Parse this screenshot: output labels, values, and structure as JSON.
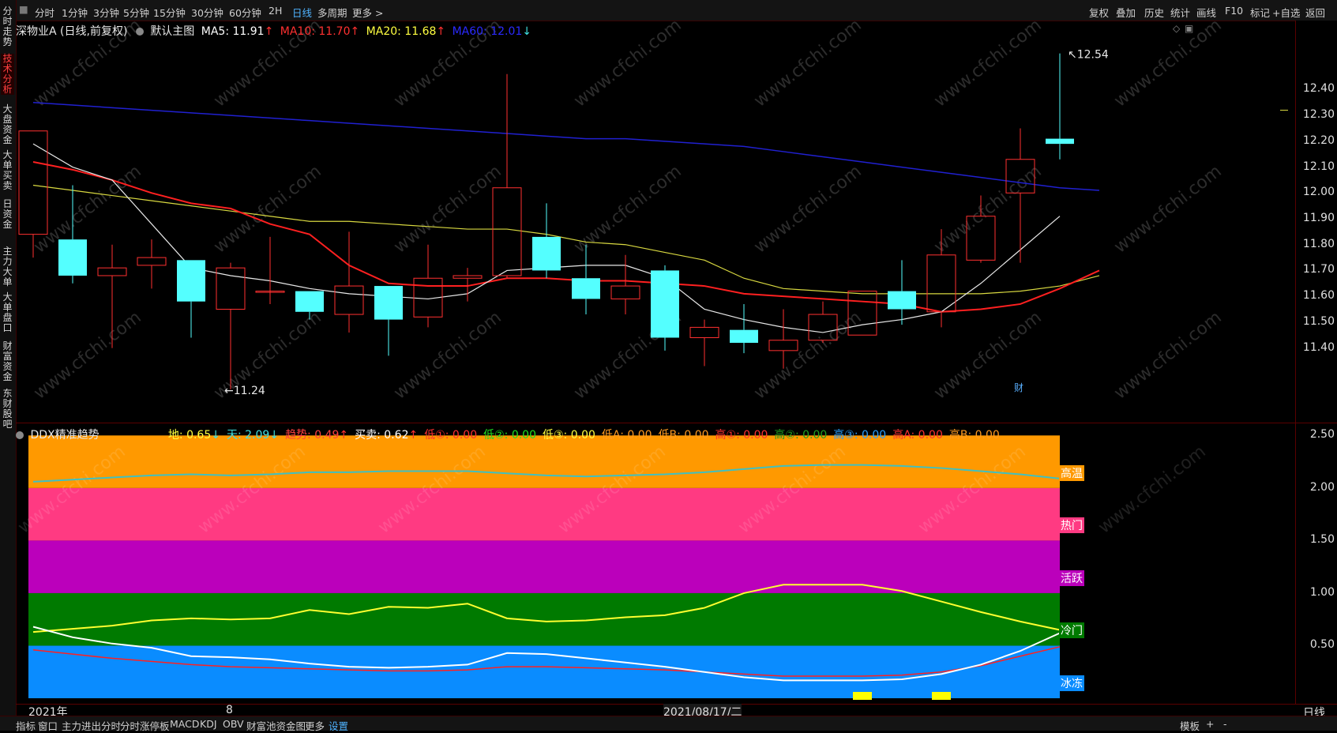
{
  "toolbar": {
    "periods": [
      "分时",
      "1分钟",
      "3分钟",
      "5分钟",
      "15分钟",
      "30分钟",
      "60分钟",
      "2H",
      "日线",
      "多周期",
      "更多 >"
    ],
    "active_period": "日线",
    "right_items": [
      "复权",
      "叠加",
      "历史",
      "统计",
      "画线",
      "F10",
      "标记",
      "+自选",
      "返回"
    ]
  },
  "side_tabs": [
    "分时走势",
    "技术分析",
    "大盘资金",
    "大单买卖",
    "日资金",
    "主力大单",
    "大单盘口",
    "财富资金",
    "东财股吧"
  ],
  "active_side_tab": "技术分析",
  "main": {
    "title": "深物业A (日线,前复权)",
    "template": "默认主图",
    "ma": [
      {
        "label": "MA5: 11.91",
        "arrow": "↑",
        "color": "#ffffff"
      },
      {
        "label": "MA10: 11.70",
        "arrow": "↑",
        "color": "#ff3030"
      },
      {
        "label": "MA20: 11.68",
        "arrow": "↑",
        "color": "#ffff40"
      },
      {
        "label": "MA60: 12.01",
        "arrow": "↓",
        "color": "#2a2aff"
      }
    ],
    "high_mark": "12.54",
    "low_mark": "11.24",
    "cai_badge": "财",
    "yticks": [
      "12.40",
      "12.30",
      "12.20",
      "12.10",
      "12.00",
      "11.90",
      "11.80",
      "11.70",
      "11.60",
      "11.50",
      "11.40"
    ]
  },
  "sub": {
    "title": "DDX精准趋势",
    "values": [
      {
        "label": "地: 0.65",
        "arrow": "↓",
        "color": "#ffff40"
      },
      {
        "label": "天: 2.09",
        "arrow": "↓",
        "color": "#40e0e0"
      },
      {
        "label": "趋势: 0.49",
        "arrow": "↑",
        "color": "#ff4040"
      },
      {
        "label": "买卖: 0.62",
        "arrow": "↑",
        "color": "#ffffff"
      },
      {
        "label": "低①: 0.00",
        "arrow": "",
        "color": "#ff3030"
      },
      {
        "label": "低②: 0.00",
        "arrow": "",
        "color": "#20e020"
      },
      {
        "label": "低③: 0.00",
        "arrow": "",
        "color": "#ffff40"
      },
      {
        "label": "低A: 0.00",
        "arrow": "",
        "color": "#ff9a20"
      },
      {
        "label": "低B: 0.00",
        "arrow": "",
        "color": "#ff9a20"
      },
      {
        "label": "高①: 0.00",
        "arrow": "",
        "color": "#ff3030"
      },
      {
        "label": "高②: 0.00",
        "arrow": "",
        "color": "#20a020"
      },
      {
        "label": "高③: 0.00",
        "arrow": "",
        "color": "#2aa0ff"
      },
      {
        "label": "高A: 0.00",
        "arrow": "",
        "color": "#ff3030"
      },
      {
        "label": "高B: 0.00",
        "arrow": "",
        "color": "#ff9a20"
      }
    ],
    "zones": [
      {
        "label": "高温",
        "color": "#ff9900",
        "text_bg": "#ff9900"
      },
      {
        "label": "热门",
        "color": "#ff3a82",
        "text_bg": "#ff3a82"
      },
      {
        "label": "活跃",
        "color": "#bb00bb",
        "text_bg": "#bb00bb"
      },
      {
        "label": "冷门",
        "color": "#007a00",
        "text_bg": "#007a00"
      },
      {
        "label": "冰冻",
        "color": "#0a8cff",
        "text_bg": "#0a8cff"
      }
    ],
    "yticks": [
      "2.50",
      "2.00",
      "1.50",
      "1.00",
      "0.50"
    ]
  },
  "xaxis": {
    "labels": [
      "2021年",
      "8",
      "2021/08/17/二"
    ],
    "right_label": "日线"
  },
  "bottom_tabs": [
    "指标",
    "窗口",
    "主力进出分时",
    "分时涨停板",
    "MACD",
    "KDJ",
    "OBV",
    "财富池资金图",
    "更多",
    "设置"
  ],
  "bottom_active": "设置",
  "bottom_right": [
    "模板",
    "+",
    "-"
  ],
  "watermark": "www.cfchi.com",
  "chart_data": {
    "type": "candlestick",
    "ylim": [
      11.2,
      12.6
    ],
    "candles": [
      {
        "o": 11.84,
        "c": 12.24,
        "h": 12.24,
        "l": 11.75
      },
      {
        "o": 11.82,
        "c": 11.68,
        "h": 12.03,
        "l": 11.65
      },
      {
        "o": 11.68,
        "c": 11.71,
        "h": 11.8,
        "l": 11.4
      },
      {
        "o": 11.72,
        "c": 11.75,
        "h": 11.82,
        "l": 11.63
      },
      {
        "o": 11.74,
        "c": 11.58,
        "h": 11.74,
        "l": 11.44
      },
      {
        "o": 11.55,
        "c": 11.71,
        "h": 11.73,
        "l": 11.24
      },
      {
        "o": 11.62,
        "c": 11.62,
        "h": 11.83,
        "l": 11.57
      },
      {
        "o": 11.62,
        "c": 11.54,
        "h": 11.62,
        "l": 11.51
      },
      {
        "o": 11.53,
        "c": 11.64,
        "h": 11.85,
        "l": 11.46
      },
      {
        "o": 11.64,
        "c": 11.51,
        "h": 11.64,
        "l": 11.37
      },
      {
        "o": 11.52,
        "c": 11.67,
        "h": 11.8,
        "l": 11.48
      },
      {
        "o": 11.67,
        "c": 11.68,
        "h": 11.71,
        "l": 11.58
      },
      {
        "o": 11.68,
        "c": 12.02,
        "h": 12.46,
        "l": 11.67
      },
      {
        "o": 11.83,
        "c": 11.7,
        "h": 11.96,
        "l": 11.67
      },
      {
        "o": 11.67,
        "c": 11.59,
        "h": 11.8,
        "l": 11.53
      },
      {
        "o": 11.59,
        "c": 11.64,
        "h": 11.76,
        "l": 11.53
      },
      {
        "o": 11.7,
        "c": 11.44,
        "h": 11.72,
        "l": 11.39
      },
      {
        "o": 11.44,
        "c": 11.48,
        "h": 11.51,
        "l": 11.33
      },
      {
        "o": 11.47,
        "c": 11.42,
        "h": 11.57,
        "l": 11.38
      },
      {
        "o": 11.39,
        "c": 11.43,
        "h": 11.55,
        "l": 11.32
      },
      {
        "o": 11.43,
        "c": 11.53,
        "h": 11.58,
        "l": 11.42
      },
      {
        "o": 11.45,
        "c": 11.62,
        "h": 11.62,
        "l": 11.45
      },
      {
        "o": 11.62,
        "c": 11.55,
        "h": 11.74,
        "l": 11.49
      },
      {
        "o": 11.54,
        "c": 11.76,
        "h": 11.86,
        "l": 11.48
      },
      {
        "o": 11.74,
        "c": 11.91,
        "h": 11.99,
        "l": 11.73
      },
      {
        "o": 12.0,
        "c": 12.13,
        "h": 12.25,
        "l": 11.73
      },
      {
        "o": 12.21,
        "c": 12.19,
        "h": 12.54,
        "l": 12.13
      }
    ],
    "ma5": [
      12.19,
      12.1,
      12.05,
      11.88,
      11.71,
      11.68,
      11.66,
      11.63,
      11.61,
      11.6,
      11.59,
      11.61,
      11.7,
      11.71,
      11.72,
      11.72,
      11.67,
      11.55,
      11.51,
      11.48,
      11.46,
      11.49,
      11.51,
      11.54,
      11.65,
      11.78,
      11.91
    ],
    "ma10": [
      12.12,
      12.09,
      12.05,
      12.0,
      11.96,
      11.94,
      11.88,
      11.84,
      11.72,
      11.65,
      11.64,
      11.64,
      11.67,
      11.67,
      11.66,
      11.66,
      11.65,
      11.64,
      11.61,
      11.6,
      11.59,
      11.58,
      11.57,
      11.54,
      11.55,
      11.57,
      11.63,
      11.7
    ],
    "ma20": [
      12.03,
      12.01,
      11.99,
      11.97,
      11.95,
      11.93,
      11.91,
      11.89,
      11.89,
      11.88,
      11.87,
      11.86,
      11.86,
      11.84,
      11.81,
      11.8,
      11.77,
      11.74,
      11.67,
      11.63,
      11.62,
      11.61,
      11.61,
      11.61,
      11.61,
      11.62,
      11.64,
      11.68
    ],
    "ma60": [
      12.35,
      12.34,
      12.33,
      12.32,
      12.31,
      12.3,
      12.29,
      12.28,
      12.27,
      12.26,
      12.25,
      12.24,
      12.23,
      12.22,
      12.21,
      12.21,
      12.2,
      12.19,
      12.18,
      12.16,
      12.14,
      12.12,
      12.1,
      12.08,
      12.06,
      12.04,
      12.02,
      12.01
    ],
    "sub_ylim": [
      0,
      2.6
    ],
    "zone_bounds": [
      0,
      0.5,
      1.0,
      1.5,
      2.0,
      2.5
    ],
    "tian": [
      2.06,
      2.08,
      2.1,
      2.12,
      2.13,
      2.12,
      2.13,
      2.15,
      2.15,
      2.16,
      2.16,
      2.16,
      2.14,
      2.12,
      2.11,
      2.12,
      2.13,
      2.15,
      2.18,
      2.21,
      2.22,
      2.22,
      2.21,
      2.19,
      2.16,
      2.13,
      2.09
    ],
    "di": [
      0.63,
      0.66,
      0.69,
      0.74,
      0.76,
      0.75,
      0.76,
      0.84,
      0.8,
      0.87,
      0.86,
      0.9,
      0.76,
      0.73,
      0.74,
      0.77,
      0.79,
      0.86,
      1.0,
      1.08,
      1.08,
      1.08,
      1.02,
      0.92,
      0.82,
      0.73,
      0.65
    ],
    "maimai": [
      0.68,
      0.58,
      0.52,
      0.48,
      0.4,
      0.39,
      0.37,
      0.33,
      0.3,
      0.29,
      0.3,
      0.32,
      0.43,
      0.42,
      0.38,
      0.34,
      0.3,
      0.25,
      0.2,
      0.17,
      0.17,
      0.17,
      0.18,
      0.23,
      0.32,
      0.45,
      0.62
    ],
    "qushi": [
      0.46,
      0.42,
      0.38,
      0.35,
      0.32,
      0.3,
      0.29,
      0.28,
      0.27,
      0.26,
      0.26,
      0.27,
      0.3,
      0.3,
      0.29,
      0.28,
      0.27,
      0.25,
      0.23,
      0.21,
      0.21,
      0.21,
      0.22,
      0.25,
      0.31,
      0.4,
      0.49
    ],
    "signals": [
      21,
      23
    ]
  }
}
